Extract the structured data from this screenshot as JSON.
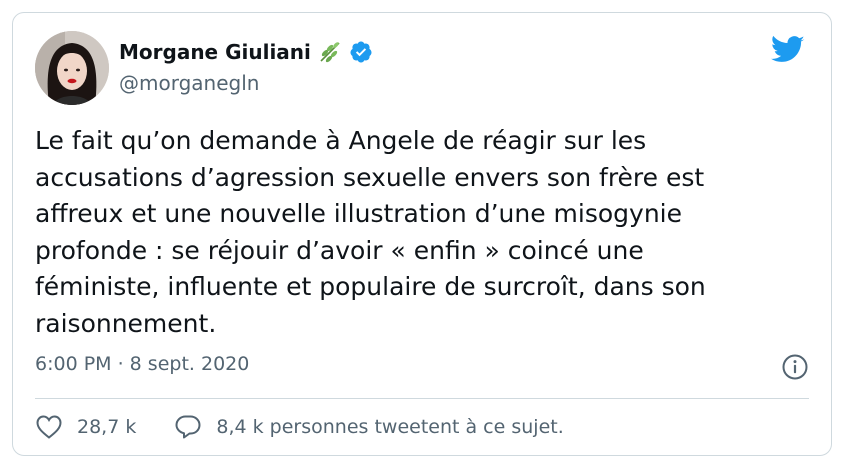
{
  "author": {
    "display_name": "Morgane Giuliani",
    "handle": "@morganegln",
    "name_emoji": "herb-emoji",
    "verified": true
  },
  "tweet": {
    "text": "Le fait qu’on demande à Angele de réagir sur les\naccusations d’agression sexuelle envers son frère est\naffreux et une nouvelle illustration d’une misogynie\nprofonde : se réjouir d’avoir « enfin » coincé une\nféministe, influente et populaire de surcroît, dans son\nraisonnement.",
    "timestamp": "6:00 PM · 8 sept. 2020"
  },
  "actions": {
    "likes": "28,7 k",
    "discussion": "8,4 k personnes tweetent à ce sujet."
  },
  "icons": {
    "logo": "twitter-bird-icon",
    "verified": "verified-badge-icon",
    "info": "info-icon",
    "like": "heart-icon",
    "reply": "speech-bubble-icon"
  },
  "colors": {
    "brand": "#1d9bf0",
    "text_primary": "#0f1419",
    "text_secondary": "#536471",
    "border": "#cfd9de",
    "emoji_green": "#6aa84f"
  }
}
